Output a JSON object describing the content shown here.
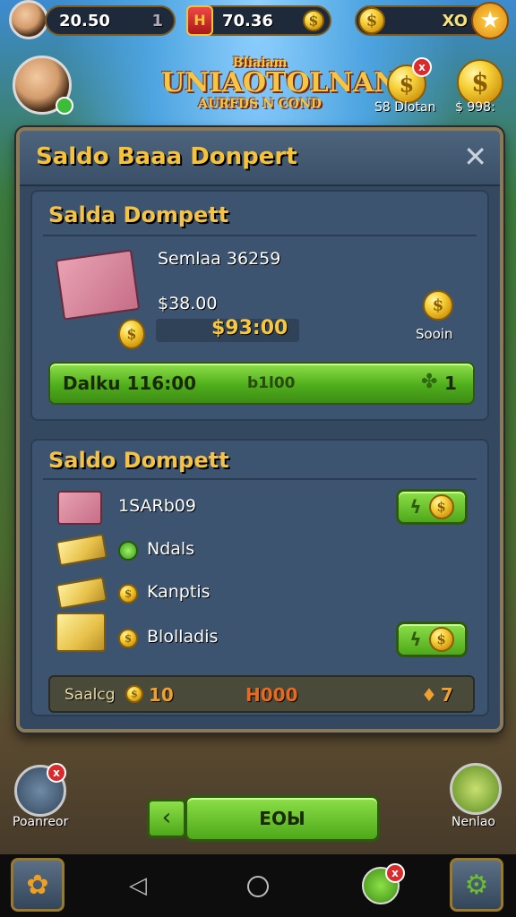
{
  "topbar": {
    "gems_value": "20.50",
    "gems_suffix": "1",
    "shield_value": "70.36",
    "coins_value": "XO"
  },
  "header": {
    "game_title_line1": "UNIAOTOLNAN!",
    "game_title_small": "Bliaiam",
    "game_title_line2": "AURFDS N COND",
    "side_label_1": "S8 Dlotan",
    "side_label_2": "$ 998:"
  },
  "panel": {
    "title": "Saldo Baaa Donpert",
    "section1": {
      "title": "Salda Dompett",
      "item_label": "Semlaa 36259",
      "price_old": "$38.00",
      "price_new": "$93:00",
      "coin_caption": "Sooin",
      "bar_left": "Dalku 116:00",
      "bar_middle": "b1l00",
      "bar_right": "1"
    },
    "section2": {
      "title": "Saldo Dompett",
      "rows": [
        {
          "label": "1SARb09"
        },
        {
          "label": "Ndals"
        },
        {
          "label": "Kanptis"
        },
        {
          "label": "Blolladis"
        }
      ],
      "footer_left": "Saalcg",
      "footer_left_value": "10",
      "footer_middle": "H000",
      "footer_right": "7"
    }
  },
  "bottom": {
    "left_label": "Poanreor",
    "right_label": "Nenlao",
    "center_button": "ЕОЫ"
  },
  "colors": {
    "accent_gold": "#f5c23a",
    "panel_bg": "#34485f",
    "button_green": "#4fae1c"
  }
}
